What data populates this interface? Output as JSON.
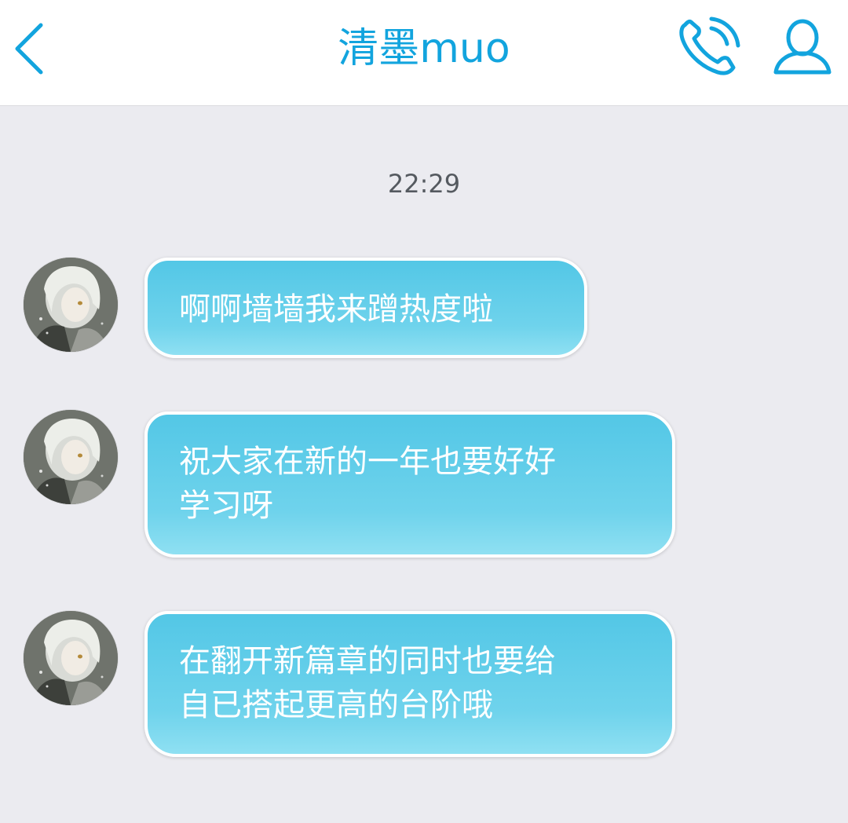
{
  "header": {
    "title": "清墨muo",
    "back_icon": "chevron-left-icon",
    "call_icon": "phone-icon",
    "profile_icon": "user-icon",
    "accent_color": "#12a4de"
  },
  "chat": {
    "timestamp": "22:29",
    "messages": [
      {
        "text": "啊啊墙墙我来蹭热度啦"
      },
      {
        "text": "祝大家在新的一年也要好好\n学习呀"
      },
      {
        "text": "在翻开新篇章的同时也要给\n自已搭起更高的台阶哦"
      }
    ]
  },
  "colors": {
    "bubble": "#5ccbe8",
    "background": "#ebebf0",
    "timestamp": "#555a60"
  }
}
